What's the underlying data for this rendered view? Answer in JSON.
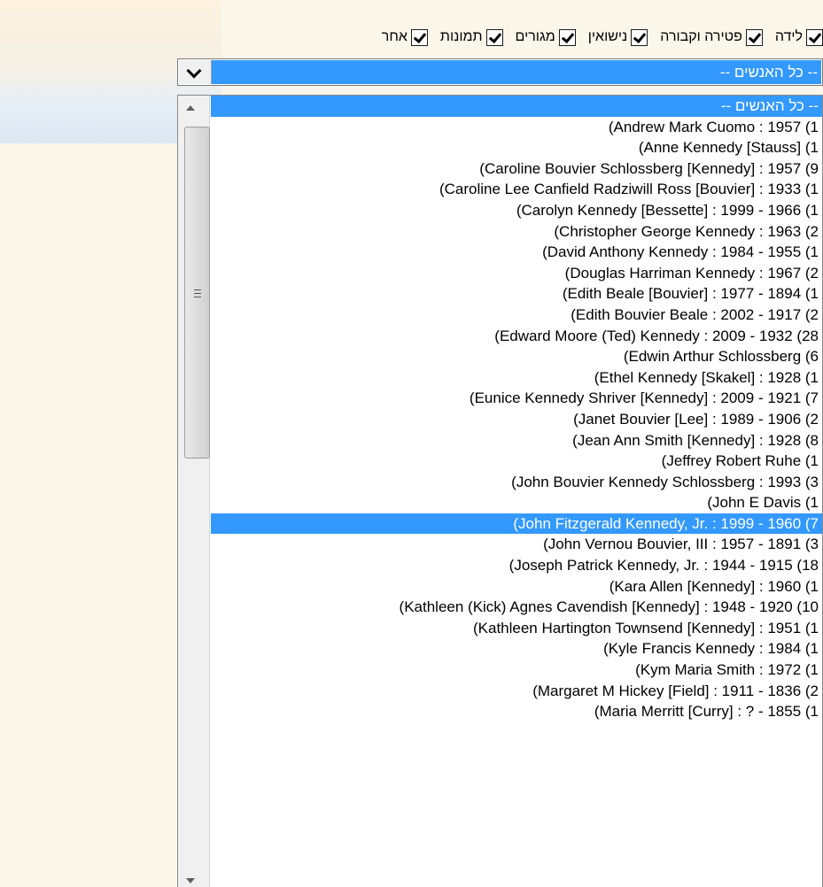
{
  "filters": [
    {
      "label": "לידה",
      "checked": true
    },
    {
      "label": "פטירה וקבורה",
      "checked": true
    },
    {
      "label": "נישואין",
      "checked": true
    },
    {
      "label": "מגורים",
      "checked": true
    },
    {
      "label": "תמונות",
      "checked": true
    },
    {
      "label": "אחר",
      "checked": true
    }
  ],
  "person_select": {
    "selected_value": "-- כל האנשים --"
  },
  "list": {
    "selected_indexes": [
      0,
      20
    ],
    "items": [
      "-- כל האנשים --",
      "(Andrew Mark Cuomo : 1957 (1",
      "(Anne Kennedy [Stauss] (1",
      "(Caroline Bouvier Schlossberg [Kennedy] : 1957 (9",
      "(Caroline Lee Canfield Radziwill Ross [Bouvier] : 1933 (1",
      "(Carolyn Kennedy [Bessette] : 1999 - 1966 (1",
      "(Christopher George Kennedy : 1963 (2",
      "(David Anthony Kennedy : 1984 - 1955 (1",
      "(Douglas Harriman Kennedy : 1967 (2",
      "(Edith Beale [Bouvier] : 1977 - 1894 (1",
      "(Edith Bouvier Beale : 2002 - 1917 (2",
      "(Edward Moore (Ted) Kennedy : 2009 - 1932 (28",
      "(Edwin Arthur Schlossberg (6",
      "(Ethel Kennedy [Skakel] : 1928 (1",
      "(Eunice Kennedy Shriver [Kennedy] : 2009 - 1921 (7",
      "(Janet Bouvier [Lee] : 1989 - 1906 (2",
      "(Jean Ann Smith [Kennedy] : 1928 (8",
      "(Jeffrey Robert Ruhe (1",
      "(John Bouvier Kennedy Schlossberg : 1993 (3",
      "(John E Davis (1",
      "(John Fitzgerald Kennedy, Jr. : 1999 - 1960 (7",
      "(John Vernou Bouvier, III : 1957 - 1891 (3",
      "(Joseph Patrick Kennedy, Jr. : 1944 - 1915 (18",
      "(Kara Allen [Kennedy] : 1960 (1",
      "(Kathleen (Kick) Agnes Cavendish [Kennedy] : 1948 - 1920 (10",
      "(Kathleen Hartington Townsend [Kennedy] : 1951 (1",
      "(Kyle Francis Kennedy : 1984 (1",
      "(Kym Maria Smith : 1972 (1",
      "(Margaret M Hickey [Field] : 1911 - 1836 (2",
      "(Maria Merritt [Curry] : ? - 1855 (1"
    ]
  },
  "icons": {
    "checkbox": "checkmark-icon",
    "combo_button": "chevron-down-icon",
    "scroll_up": "arrow-up-icon",
    "scroll_down": "arrow-down-icon",
    "thumb_grip": "grip-icon"
  },
  "colors": {
    "selection": "#3399ff",
    "background": "#fbf6ea"
  }
}
